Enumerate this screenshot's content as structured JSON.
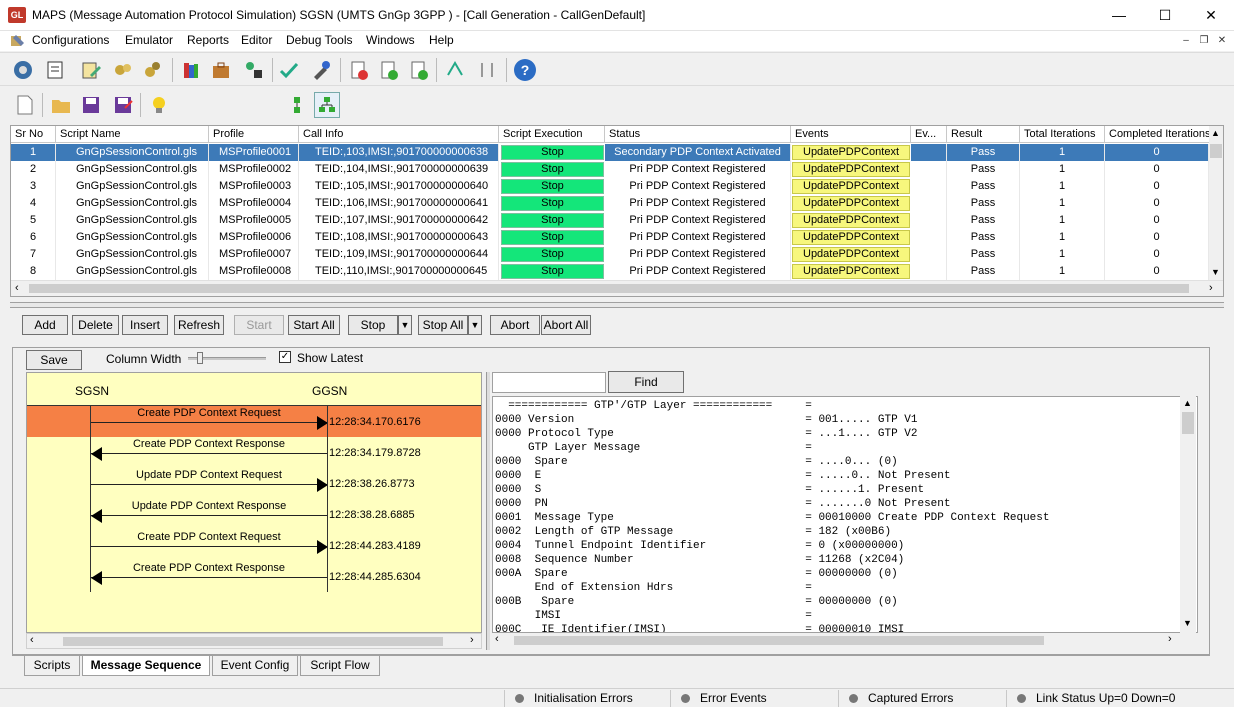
{
  "window": {
    "title": "MAPS (Message Automation Protocol Simulation) SGSN (UMTS GnGp 3GPP ) - [Call Generation  - CallGenDefault]",
    "icon": "gl-logo-icon",
    "icon_text": "GL"
  },
  "menu": {
    "items": [
      "Configurations",
      "Emulator",
      "Reports",
      "Editor",
      "Debug Tools",
      "Windows",
      "Help"
    ]
  },
  "grid": {
    "columns": [
      "Sr No",
      "Script Name",
      "Profile",
      "Call Info",
      "Script Execution",
      "Status",
      "Events",
      "Ev...",
      "Result",
      "Total Iterations",
      "Completed Iterations"
    ],
    "rows": [
      {
        "sr": "1",
        "script": "GnGpSessionControl.gls",
        "profile": "MSProfile0001",
        "callinfo": "TEID:,103,IMSI:,901700000000638",
        "exec": "Stop",
        "status": "Secondary PDP Context Activated",
        "events": "UpdatePDPContext",
        "ev": "",
        "result": "Pass",
        "total": "1",
        "completed": "0"
      },
      {
        "sr": "2",
        "script": "GnGpSessionControl.gls",
        "profile": "MSProfile0002",
        "callinfo": "TEID:,104,IMSI:,901700000000639",
        "exec": "Stop",
        "status": "Pri PDP Context Registered",
        "events": "UpdatePDPContext",
        "ev": "",
        "result": "Pass",
        "total": "1",
        "completed": "0"
      },
      {
        "sr": "3",
        "script": "GnGpSessionControl.gls",
        "profile": "MSProfile0003",
        "callinfo": "TEID:,105,IMSI:,901700000000640",
        "exec": "Stop",
        "status": "Pri PDP Context Registered",
        "events": "UpdatePDPContext",
        "ev": "",
        "result": "Pass",
        "total": "1",
        "completed": "0"
      },
      {
        "sr": "4",
        "script": "GnGpSessionControl.gls",
        "profile": "MSProfile0004",
        "callinfo": "TEID:,106,IMSI:,901700000000641",
        "exec": "Stop",
        "status": "Pri PDP Context Registered",
        "events": "UpdatePDPContext",
        "ev": "",
        "result": "Pass",
        "total": "1",
        "completed": "0"
      },
      {
        "sr": "5",
        "script": "GnGpSessionControl.gls",
        "profile": "MSProfile0005",
        "callinfo": "TEID:,107,IMSI:,901700000000642",
        "exec": "Stop",
        "status": "Pri PDP Context Registered",
        "events": "UpdatePDPContext",
        "ev": "",
        "result": "Pass",
        "total": "1",
        "completed": "0"
      },
      {
        "sr": "6",
        "script": "GnGpSessionControl.gls",
        "profile": "MSProfile0006",
        "callinfo": "TEID:,108,IMSI:,901700000000643",
        "exec": "Stop",
        "status": "Pri PDP Context Registered",
        "events": "UpdatePDPContext",
        "ev": "",
        "result": "Pass",
        "total": "1",
        "completed": "0"
      },
      {
        "sr": "7",
        "script": "GnGpSessionControl.gls",
        "profile": "MSProfile0007",
        "callinfo": "TEID:,109,IMSI:,901700000000644",
        "exec": "Stop",
        "status": "Pri PDP Context Registered",
        "events": "UpdatePDPContext",
        "ev": "",
        "result": "Pass",
        "total": "1",
        "completed": "0"
      },
      {
        "sr": "8",
        "script": "GnGpSessionControl.gls",
        "profile": "MSProfile0008",
        "callinfo": "TEID:,110,IMSI:,901700000000645",
        "exec": "Stop",
        "status": "Pri PDP Context Registered",
        "events": "UpdatePDPContext",
        "ev": "",
        "result": "Pass",
        "total": "1",
        "completed": "0"
      }
    ],
    "selected_row": 0
  },
  "actions": {
    "add": "Add",
    "delete": "Delete",
    "insert": "Insert",
    "refresh": "Refresh",
    "start": "Start",
    "start_all": "Start All",
    "stop": "Stop",
    "stop_all": "Stop All",
    "abort": "Abort",
    "abort_all": "Abort All"
  },
  "seq_toolbar": {
    "save": "Save",
    "column_width_label": "Column Width",
    "show_latest_label": "Show Latest",
    "show_latest_checked": true
  },
  "sequence": {
    "left_node": "SGSN",
    "right_node": "GGSN",
    "messages": [
      {
        "label": "Create PDP Context Request",
        "time": "12:28:34.170.6176",
        "direction": "right",
        "highlight": true
      },
      {
        "label": "Create PDP Context Response",
        "time": "12:28:34.179.8728",
        "direction": "left",
        "highlight": false
      },
      {
        "label": "Update PDP Context Request",
        "time": "12:28:38.26.8773",
        "direction": "right",
        "highlight": false
      },
      {
        "label": "Update PDP Context Response",
        "time": "12:28:38.28.6885",
        "direction": "left",
        "highlight": false
      },
      {
        "label": "Create PDP Context Request",
        "time": "12:28:44.283.4189",
        "direction": "right",
        "highlight": false
      },
      {
        "label": "Create PDP Context Response",
        "time": "12:28:44.285.6304",
        "direction": "left",
        "highlight": false
      }
    ],
    "highlight_color": "#f58045",
    "panel_color": "#ffffc0"
  },
  "detail": {
    "find_value": "",
    "find_button": "Find",
    "lines": [
      "  ============ GTP'/GTP Layer ============     =",
      "0000 Version                                   = 001..... GTP V1",
      "0000 Protocol Type                             = ...1.... GTP V2",
      "     GTP Layer Message                         =",
      "0000  Spare                                    = ....0... (0)",
      "0000  E                                        = .....0.. Not Present",
      "0000  S                                        = ......1. Present",
      "0000  PN                                       = .......0 Not Present",
      "0001  Message Type                             = 00010000 Create PDP Context Request",
      "0002  Length of GTP Message                    = 182 (x00B6)",
      "0004  Tunnel Endpoint Identifier               = 0 (x00000000)",
      "0008  Sequence Number                          = 11268 (x2C04)",
      "000A  Spare                                    = 00000000 (0)",
      "      End of Extension Hdrs                    =",
      "000B   Spare                                   = 00000000 (0)",
      "      IMSI                                     =",
      "000C   IE Identifier(IMSI)                     = 00000010 IMSI"
    ]
  },
  "tabs": [
    "Scripts",
    "Message Sequence",
    "Event Config",
    "Script Flow"
  ],
  "active_tab": "Message Sequence",
  "status": {
    "init_errors": "Initialisation Errors",
    "error_events": "Error Events",
    "captured_errors": "Captured Errors",
    "link_status": "Link Status Up=0 Down=0"
  },
  "colors": {
    "stop_green": "#14e67a",
    "event_yellow": "#f7f77d",
    "selection_blue": "#3d7ab8"
  }
}
